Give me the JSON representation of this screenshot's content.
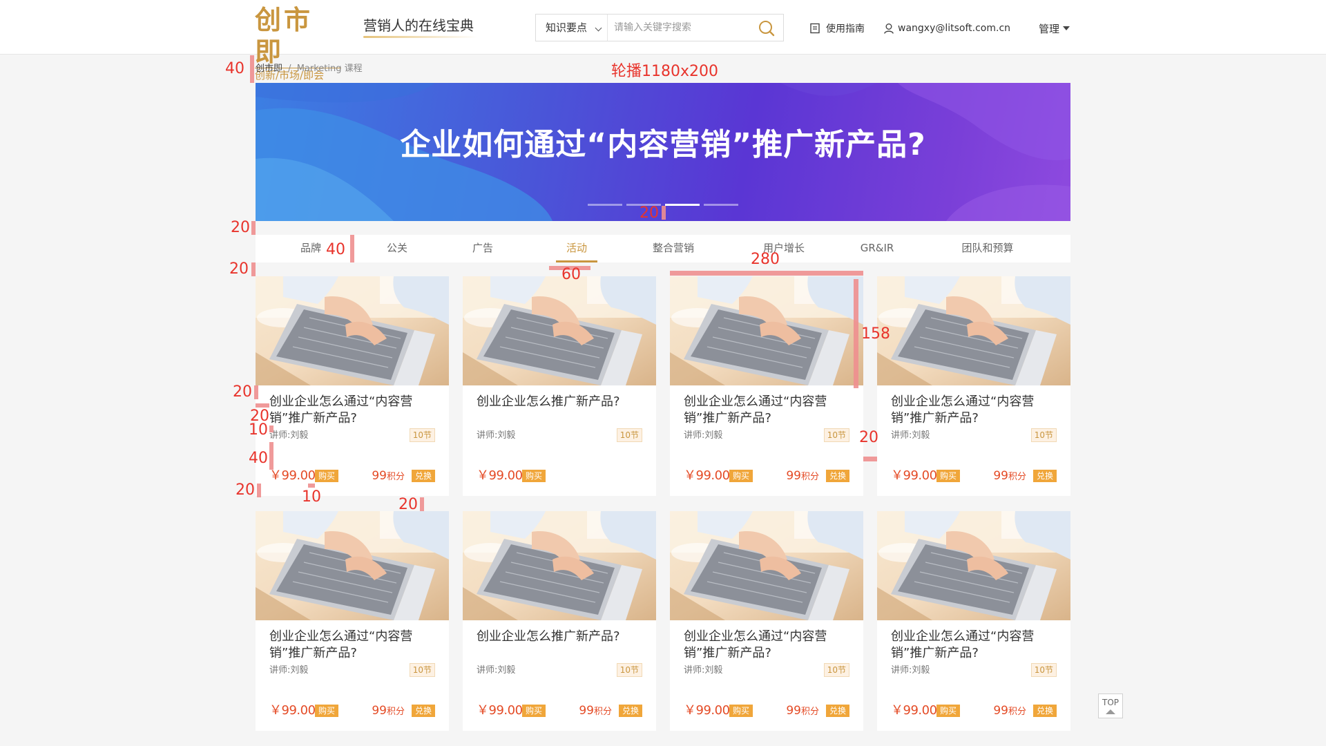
{
  "header": {
    "logo_main": "创市即",
    "logo_sub": "创新/市场/即会",
    "slogan": "营销人的在线宝典",
    "search": {
      "category": "知识要点",
      "placeholder": "请输入关键字搜索"
    },
    "guide_label": "使用指南",
    "user_email": "wangxy@litsoft.com.cn",
    "manage_label": "管理"
  },
  "breadcrumb": {
    "home": "创市即",
    "separator": "/",
    "current": "Marketing 课程"
  },
  "banner": {
    "title": "企业如何通过“内容营销”推广新产品?",
    "dots": 4,
    "active_dot": 3
  },
  "tabs": [
    {
      "label": "品牌",
      "active": false
    },
    {
      "label": "公关",
      "active": false
    },
    {
      "label": "广告",
      "active": false
    },
    {
      "label": "活动",
      "active": true
    },
    {
      "label": "整合营销",
      "active": false
    },
    {
      "label": "用户增长",
      "active": false
    },
    {
      "label": "GR&IR",
      "active": false
    },
    {
      "label": "团队和预算",
      "active": false
    }
  ],
  "cards": [
    {
      "title": "创业企业怎么通过“内容营销”推广新产品?",
      "teacher": "讲师:刘毅",
      "lessons": "10节",
      "price": "￥99.00",
      "buy": "购买",
      "points": "99",
      "points_unit": "积分",
      "exchange": "兑换"
    },
    {
      "title": "创业企业怎么推广新产品?",
      "teacher": "讲师:刘毅",
      "lessons": "10节",
      "price": "￥99.00",
      "buy": "购买",
      "points": "",
      "points_unit": "",
      "exchange": ""
    },
    {
      "title": "创业企业怎么通过“内容营销”推广新产品?",
      "teacher": "讲师:刘毅",
      "lessons": "10节",
      "price": "￥99.00",
      "buy": "购买",
      "points": "99",
      "points_unit": "积分",
      "exchange": "兑换"
    },
    {
      "title": "创业企业怎么通过“内容营销”推广新产品?",
      "teacher": "讲师:刘毅",
      "lessons": "10节",
      "price": "￥99.00",
      "buy": "购买",
      "points": "99",
      "points_unit": "积分",
      "exchange": "兑换"
    },
    {
      "title": "创业企业怎么通过“内容营销”推广新产品?",
      "teacher": "讲师:刘毅",
      "lessons": "10节",
      "price": "￥99.00",
      "buy": "购买",
      "points": "99",
      "points_unit": "积分",
      "exchange": "兑换"
    },
    {
      "title": "创业企业怎么推广新产品?",
      "teacher": "讲师:刘毅",
      "lessons": "10节",
      "price": "￥99.00",
      "buy": "购买",
      "points": "99",
      "points_unit": "积分",
      "exchange": "兑换"
    },
    {
      "title": "创业企业怎么通过“内容营销”推广新产品?",
      "teacher": "讲师:刘毅",
      "lessons": "10节",
      "price": "￥99.00",
      "buy": "购买",
      "points": "99",
      "points_unit": "积分",
      "exchange": "兑换"
    },
    {
      "title": "创业企业怎么通过“内容营销”推广新产品?",
      "teacher": "讲师:刘毅",
      "lessons": "10节",
      "price": "￥99.00",
      "buy": "购买",
      "points": "99",
      "points_unit": "积分",
      "exchange": "兑换"
    }
  ],
  "back_to_top": "TOP",
  "annotations": {
    "banner_size": "轮播1180x200",
    "a40_breadcrumb": "40",
    "a20_banner_gap": "20",
    "a20_dots": "20",
    "a20_tabs_gap": "20",
    "a40_tab": "40",
    "a60_tab_underline": "60",
    "a280_card_width": "280",
    "a158_thumb_height": "158",
    "a20_title_top": "20",
    "a20_title_left": "20",
    "a10_teacher": "10",
    "a40_price_gap": "40",
    "a20_card_bottom": "20",
    "a10_buy_gap": "10",
    "a20_row_gap": "20",
    "a20_col_gap": "20"
  },
  "colors": {
    "brand_gold": "#c9963f",
    "price_red": "#e44b26",
    "tag_orange": "#f0a63a",
    "annotation_red": "#e8342c",
    "banner_start": "#3c7fe3",
    "banner_end": "#8e4adf"
  }
}
